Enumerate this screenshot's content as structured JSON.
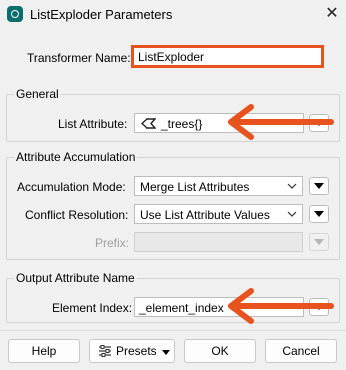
{
  "window": {
    "title": "ListExploder Parameters",
    "close_glyph": "✕"
  },
  "transformer": {
    "name_label": "Transformer Name:",
    "name_value": "ListExploder"
  },
  "general": {
    "title": "General",
    "list_attribute_label": "List Attribute:",
    "list_attribute_value": "_trees{}"
  },
  "accumulation": {
    "title": "Attribute Accumulation",
    "mode_label": "Accumulation Mode:",
    "mode_value": "Merge List Attributes",
    "conflict_label": "Conflict Resolution:",
    "conflict_value": "Use List Attribute Values",
    "prefix_label": "Prefix:",
    "prefix_value": ""
  },
  "output": {
    "title": "Output Attribute Name",
    "element_index_label": "Element Index:",
    "element_index_value": "_element_index"
  },
  "buttons": {
    "help": "Help",
    "presets": "Presets",
    "ok": "OK",
    "cancel": "Cancel"
  },
  "annotation_color": "#e8521f",
  "icons": [
    "app-icon",
    "close-icon",
    "list-attribute-icon",
    "chevron-down-icon",
    "menu-triangle-icon",
    "presets-icon",
    "arrow-annotation-icon"
  ]
}
